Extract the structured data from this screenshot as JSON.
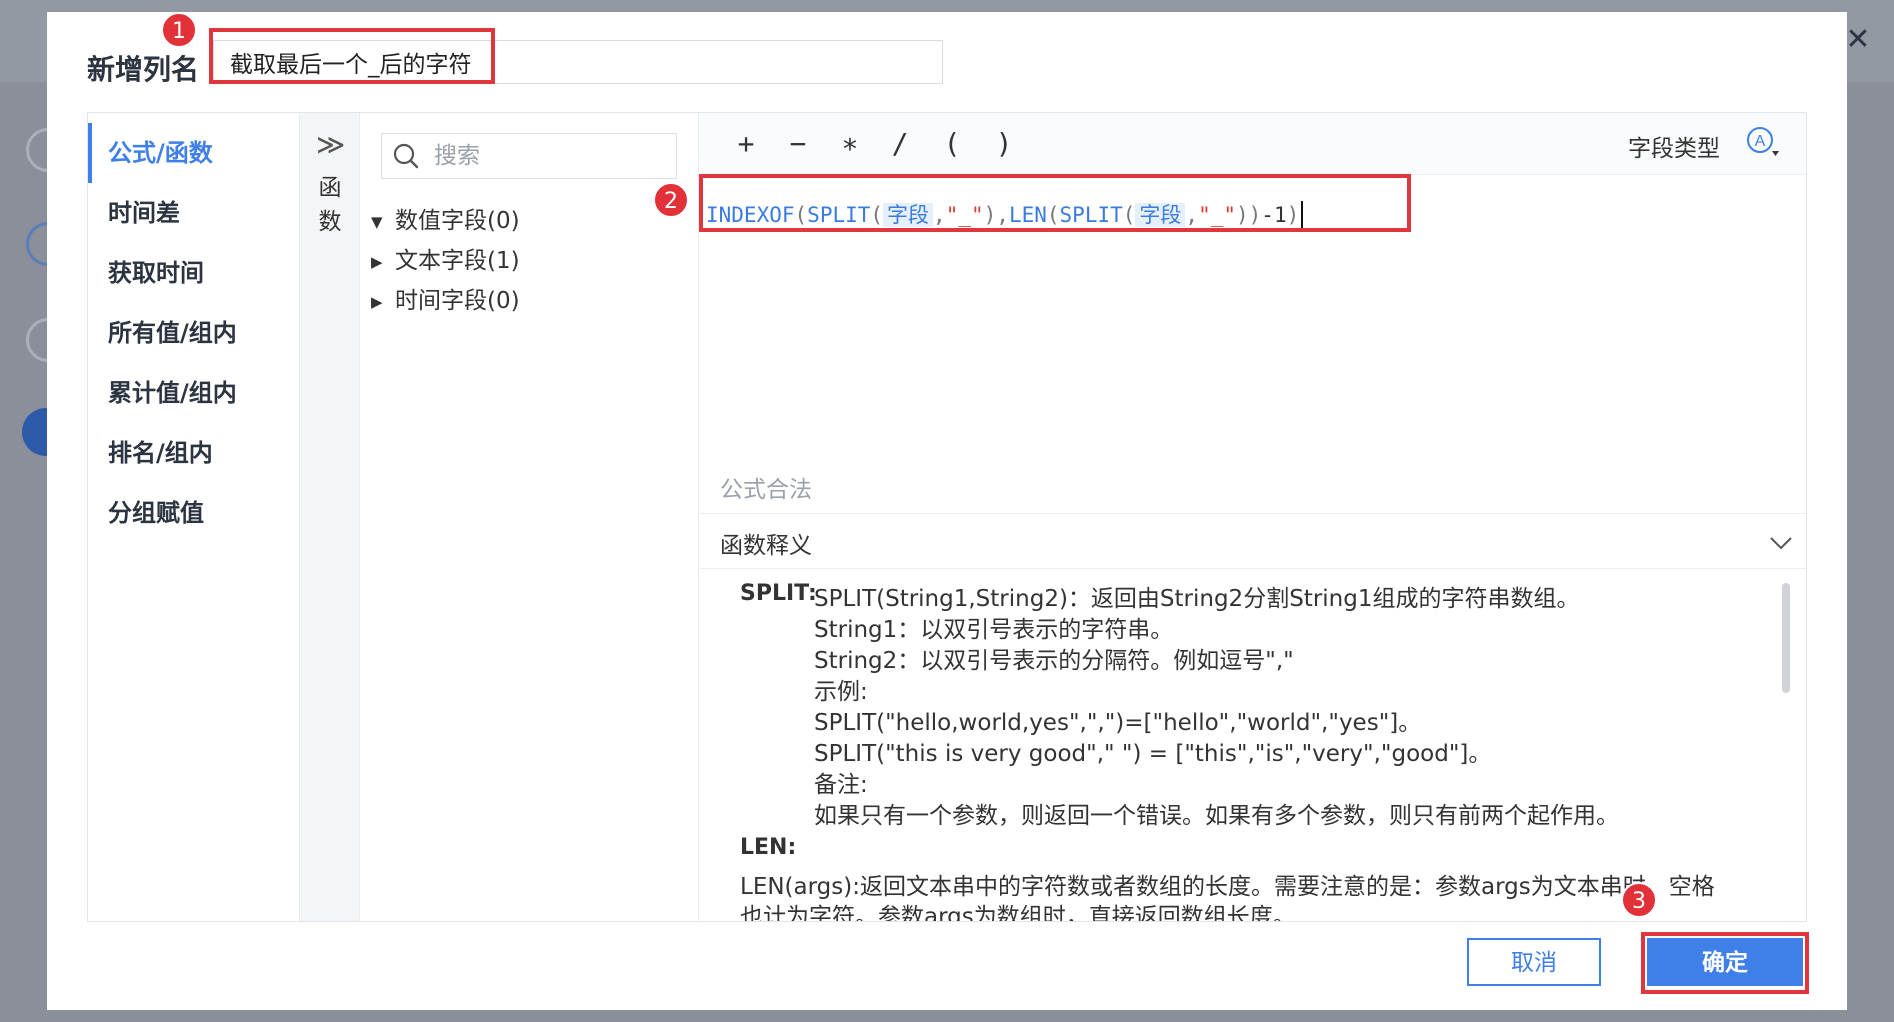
{
  "dialog": {
    "title": "新增列名",
    "column_name_value": "截取最后一个_后的字符",
    "close_glyph": "✕"
  },
  "left_nav": {
    "items": [
      {
        "label": "公式/函数",
        "active": true
      },
      {
        "label": "时间差",
        "active": false
      },
      {
        "label": "获取时间",
        "active": false
      },
      {
        "label": "所有值/组内",
        "active": false
      },
      {
        "label": "累计值/组内",
        "active": false
      },
      {
        "label": "排名/组内",
        "active": false
      },
      {
        "label": "分组赋值",
        "active": false
      }
    ]
  },
  "collapse": {
    "glyph": "≫",
    "label_line1": "函",
    "label_line2": "数"
  },
  "fields": {
    "search_placeholder": "搜索",
    "groups": [
      {
        "label": "数值字段(0)",
        "expanded": true
      },
      {
        "label": "文本字段(1)",
        "expanded": false
      },
      {
        "label": "时间字段(0)",
        "expanded": false
      }
    ],
    "expanded_glyph": "▼",
    "collapsed_glyph": "▶"
  },
  "toolbar": {
    "operators": [
      "+",
      "−",
      "∗",
      "/",
      "(",
      ")"
    ],
    "field_type_label": "字段类型",
    "field_type_icon": "field-type-a-icon"
  },
  "formula": {
    "t1": "INDEXOF",
    "t2": "(",
    "t3": "SPLIT",
    "t4": "(",
    "t5": "字段",
    "t6": ",",
    "t7": "\"_\"",
    "t8": "),",
    "t9": "LEN",
    "t10": "(",
    "t11": "SPLIT",
    "t12": "(",
    "t13": "字段",
    "t14": ",",
    "t15": "\"_\"",
    "t16": "))",
    "t17": "-1",
    "t18": ")"
  },
  "validity_text": "公式合法",
  "explain": {
    "title": "函数释义",
    "split_name": "SPLIT:",
    "split_lines": [
      "SPLIT(String1,String2)：返回由String2分割String1组成的字符串数组。",
      "String1：以双引号表示的字符串。",
      "String2：以双引号表示的分隔符。例如逗号\",\"",
      "示例:",
      "SPLIT(\"hello,world,yes\",\",\")=[\"hello\",\"world\",\"yes\"]。",
      "SPLIT(\"this is very good\",\" \") = [\"this\",\"is\",\"very\",\"good\"]。",
      "备注:",
      "如果只有一个参数，则返回一个错误。如果有多个参数，则只有前两个起作用。"
    ],
    "len_name": "LEN:",
    "len_lines": [
      "LEN(args):返回文本串中的字符数或者数组的长度。需要注意的是：参数args为文本串时，空格",
      "也计为字符。参数args为数组时，直接返回数组长度。"
    ]
  },
  "buttons": {
    "cancel": "取消",
    "ok": "确定"
  },
  "annotations": {
    "badge1": "1",
    "badge2": "2",
    "badge3": "3",
    "highlight_color": "#e0373f"
  },
  "colors": {
    "accent": "#3f80e8",
    "string_literal": "#d93d2f"
  }
}
